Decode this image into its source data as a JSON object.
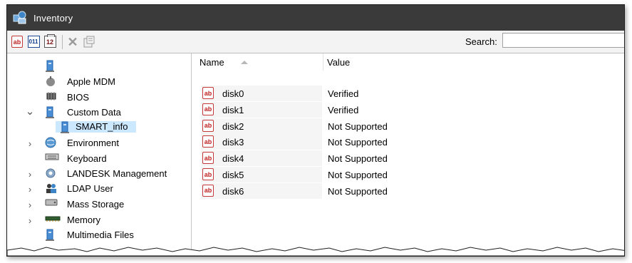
{
  "window": {
    "title": "Inventory"
  },
  "toolbar": {
    "buttons": [
      {
        "icon": "ab-string-icon",
        "text": "ab"
      },
      {
        "icon": "binary-icon",
        "text": "011"
      },
      {
        "icon": "number-icon",
        "text": "12"
      },
      {
        "icon": "delete-icon",
        "text": "✕"
      },
      {
        "icon": "properties-icon",
        "text": ""
      }
    ],
    "search_label": "Search:",
    "search_value": ""
  },
  "tree": {
    "items": [
      {
        "label": "",
        "expander": "",
        "icon": "computer-icon"
      },
      {
        "label": "Apple MDM",
        "expander": "",
        "icon": "apple-icon"
      },
      {
        "label": "BIOS",
        "expander": "",
        "icon": "bios-chip-icon"
      },
      {
        "label": "Custom Data",
        "expander": "expanded",
        "icon": "computer-icon"
      },
      {
        "label": "SMART_info",
        "expander": "",
        "icon": "computer-icon",
        "selected": true
      },
      {
        "label": "Environment",
        "expander": "collapsed",
        "icon": "globe-icon"
      },
      {
        "label": "Keyboard",
        "expander": "",
        "icon": "keyboard-icon"
      },
      {
        "label": "LANDESK Management",
        "expander": "collapsed",
        "icon": "gear-icon"
      },
      {
        "label": "LDAP User",
        "expander": "collapsed",
        "icon": "users-icon"
      },
      {
        "label": "Mass Storage",
        "expander": "collapsed",
        "icon": "hard-drive-icon"
      },
      {
        "label": "Memory",
        "expander": "collapsed",
        "icon": "memory-icon"
      },
      {
        "label": "Multimedia Files",
        "expander": "",
        "icon": "computer-icon"
      }
    ]
  },
  "list": {
    "columns": {
      "name": "Name",
      "value": "Value"
    },
    "sort": "ascending",
    "rows": [
      {
        "name": "disk0",
        "value": "Verified"
      },
      {
        "name": "disk1",
        "value": "Verified"
      },
      {
        "name": "disk2",
        "value": "Not Supported"
      },
      {
        "name": "disk3",
        "value": "Not Supported"
      },
      {
        "name": "disk4",
        "value": "Not Supported"
      },
      {
        "name": "disk5",
        "value": "Not Supported"
      },
      {
        "name": "disk6",
        "value": "Not Supported"
      }
    ]
  },
  "colors": {
    "titlebar": "#3a3a3a",
    "selection": "#cce8ff",
    "ab_red": "#c02222"
  }
}
